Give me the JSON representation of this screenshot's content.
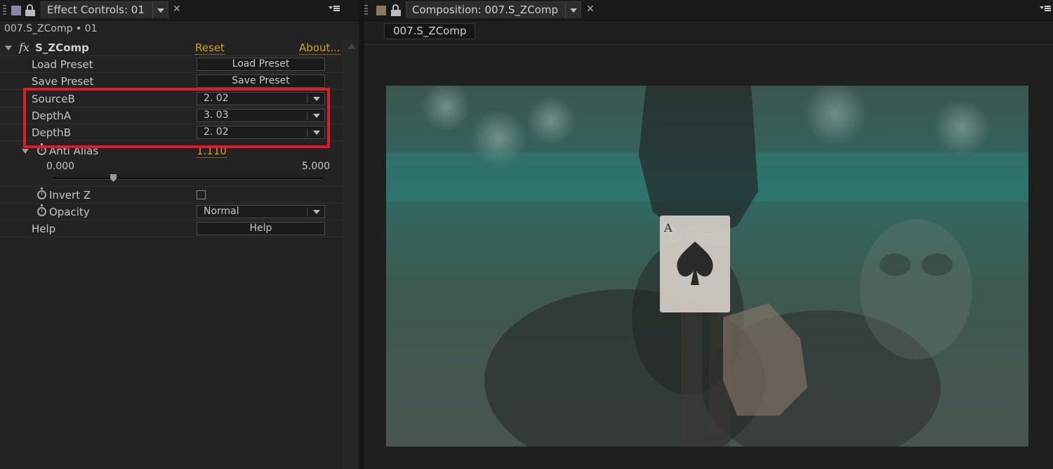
{
  "effect_panel": {
    "tab_title": "Effect Controls: 01",
    "subtitle": "007.S_ZComp • 01",
    "effect": {
      "fx_symbol": "fx",
      "name": "S_ZComp",
      "reset_label": "Reset",
      "about_label": "About..."
    },
    "rows": {
      "load_preset": {
        "label": "Load Preset",
        "button": "Load Preset"
      },
      "save_preset": {
        "label": "Save Preset",
        "button": "Save Preset"
      },
      "source_b": {
        "label": "SourceB",
        "value": "2. 02"
      },
      "depth_a": {
        "label": "DepthA",
        "value": "3. 03"
      },
      "depth_b": {
        "label": "DepthB",
        "value": "2. 02"
      },
      "anti_alias": {
        "label": "Anti Alias",
        "value": "1.110",
        "slider_min": "0.000",
        "slider_max": "5.000",
        "slider_fraction": 0.222
      },
      "invert_z": {
        "label": "Invert Z",
        "checked": false
      },
      "opacity": {
        "label": "Opacity",
        "value": "Normal"
      },
      "help": {
        "label": "Help",
        "button": "Help"
      }
    },
    "accent_color": "#d79d2b",
    "highlight_color": "#e01b24"
  },
  "comp_panel": {
    "tab_title": "Composition: 007.S_ZComp",
    "view_tab": "007.S_ZComp",
    "swatch_color": "#8a7a5c"
  },
  "icons": [
    "lock-icon",
    "panel-menu-icon",
    "close-icon",
    "dropdown-arrow-icon",
    "stopwatch-icon",
    "twirl-down-icon",
    "scroll-up-icon"
  ]
}
